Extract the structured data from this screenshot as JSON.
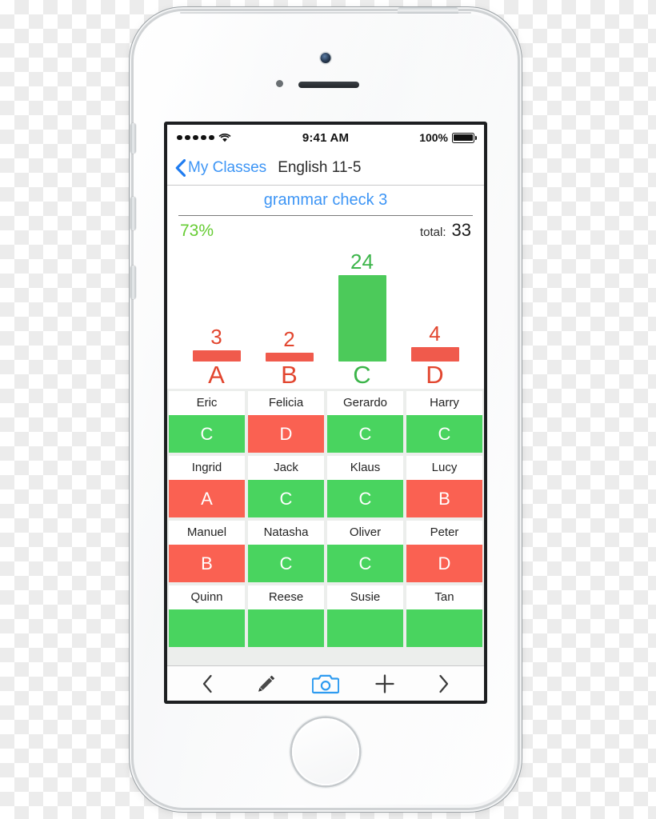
{
  "device": {
    "name": "iphone-5s-silver",
    "home_button": "home-button",
    "front_camera": "front-camera",
    "speaker": "earpiece-speaker"
  },
  "status_bar": {
    "signal_dots": 5,
    "wifi_icon": "wifi-icon",
    "time": "9:41 AM",
    "battery_percent": "100%",
    "battery_icon": "battery-full-icon"
  },
  "nav_bar": {
    "back_icon": "chevron-left-icon",
    "back_label": "My Classes",
    "title": "English 11-5"
  },
  "assignment": {
    "title": "grammar check 3",
    "percent": "73%",
    "total_label": "total:",
    "total_value": "33"
  },
  "chart_data": {
    "type": "bar",
    "title": "grammar check 3",
    "categories": [
      "A",
      "B",
      "C",
      "D"
    ],
    "values": [
      3,
      2,
      24,
      4
    ],
    "value_labels": [
      "3",
      "2",
      "24",
      "4"
    ],
    "colors": [
      "#f05a4c",
      "#f05a4c",
      "#4cca5a",
      "#f05a4c"
    ],
    "label_colors": [
      "#e2462f",
      "#e2462f",
      "#3cb54a",
      "#e2462f"
    ],
    "xlabel": "",
    "ylabel": "",
    "ylim": [
      0,
      24
    ],
    "grid": false,
    "legend": false,
    "total": 33,
    "percent_correct": "73%"
  },
  "colors": {
    "accent_blue": "#3d95f5",
    "green": "#49d45f",
    "red": "#fa6152",
    "chart_green": "#4cca5a",
    "chart_red": "#f05a4c",
    "percent_green": "#66cc33"
  },
  "students": [
    {
      "name": "Eric",
      "grade": "C",
      "status": "green"
    },
    {
      "name": "Felicia",
      "grade": "D",
      "status": "red"
    },
    {
      "name": "Gerardo",
      "grade": "C",
      "status": "green"
    },
    {
      "name": "Harry",
      "grade": "C",
      "status": "green"
    },
    {
      "name": "Ingrid",
      "grade": "A",
      "status": "red"
    },
    {
      "name": "Jack",
      "grade": "C",
      "status": "green"
    },
    {
      "name": "Klaus",
      "grade": "C",
      "status": "green"
    },
    {
      "name": "Lucy",
      "grade": "B",
      "status": "red"
    },
    {
      "name": "Manuel",
      "grade": "B",
      "status": "red"
    },
    {
      "name": "Natasha",
      "grade": "C",
      "status": "green"
    },
    {
      "name": "Oliver",
      "grade": "C",
      "status": "green"
    },
    {
      "name": "Peter",
      "grade": "D",
      "status": "red"
    },
    {
      "name": "Quinn",
      "grade": "",
      "status": "green"
    },
    {
      "name": "Reese",
      "grade": "",
      "status": "green"
    },
    {
      "name": "Susie",
      "grade": "",
      "status": "green"
    },
    {
      "name": "Tan",
      "grade": "",
      "status": "green"
    }
  ],
  "toolbar": {
    "items": [
      {
        "icon": "chevron-left-icon",
        "label": "previous"
      },
      {
        "icon": "pencil-icon",
        "label": "edit"
      },
      {
        "icon": "camera-icon",
        "label": "scan"
      },
      {
        "icon": "plus-icon",
        "label": "add"
      },
      {
        "icon": "chevron-right-icon",
        "label": "next"
      }
    ]
  }
}
